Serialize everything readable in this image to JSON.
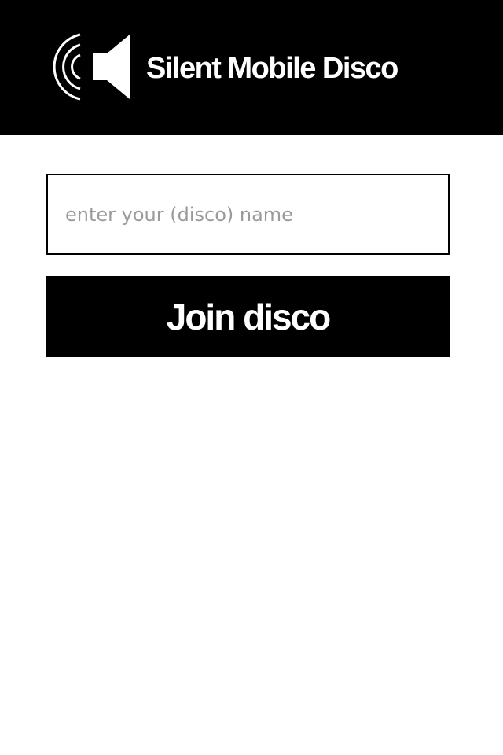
{
  "header": {
    "title": "Silent Mobile Disco",
    "logo_icon": "speaker-sound-waves-icon",
    "background": "#000000",
    "text_color": "#ffffff"
  },
  "form": {
    "name_input": {
      "placeholder": "enter your (disco) name",
      "value": ""
    },
    "join_button_label": "Join disco"
  }
}
